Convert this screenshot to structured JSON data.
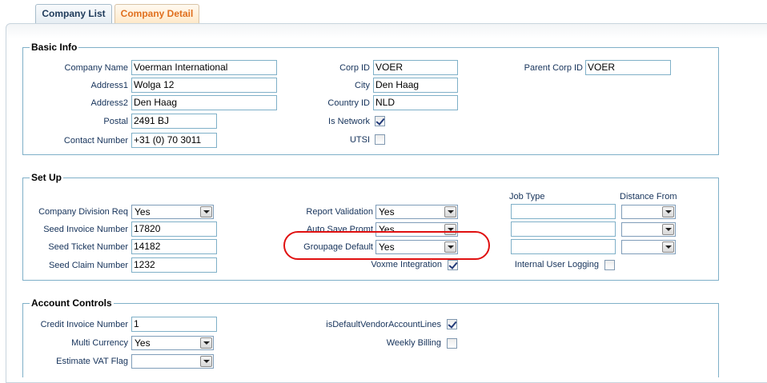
{
  "tabs": {
    "company_list": "Company List",
    "company_detail": "Company Detail"
  },
  "basic_info": {
    "legend": "Basic Info",
    "company_name": {
      "label": "Company Name",
      "value": "Voerman International"
    },
    "address1": {
      "label": "Address1",
      "value": "Wolga 12"
    },
    "address2": {
      "label": "Address2",
      "value": "Den Haag"
    },
    "postal": {
      "label": "Postal",
      "value": "2491 BJ"
    },
    "contact_number": {
      "label": "Contact Number",
      "value": "+31 (0) 70 3011"
    },
    "corp_id": {
      "label": "Corp ID",
      "value": "VOER"
    },
    "city": {
      "label": "City",
      "value": "Den Haag"
    },
    "country_id": {
      "label": "Country ID",
      "value": "NLD"
    },
    "is_network": {
      "label": "Is Network",
      "checked": true
    },
    "utsi": {
      "label": "UTSI",
      "checked": false
    },
    "parent_corp_id": {
      "label": "Parent Corp ID",
      "value": "VOER"
    }
  },
  "set_up": {
    "legend": "Set Up",
    "company_division_req": {
      "label": "Company Division Req",
      "value": "Yes"
    },
    "seed_invoice_number": {
      "label": "Seed Invoice Number",
      "value": "17820"
    },
    "seed_ticket_number": {
      "label": "Seed Ticket Number",
      "value": "14182"
    },
    "seed_claim_number": {
      "label": "Seed Claim Number",
      "value": "1232"
    },
    "report_validation": {
      "label": "Report Validation",
      "value": "Yes"
    },
    "auto_save_promt": {
      "label": "Auto Save Promt",
      "value": "Yes"
    },
    "groupage_default": {
      "label": "Groupage Default",
      "value": "Yes"
    },
    "voxme_integration": {
      "label": "Voxme Integration",
      "checked": true
    },
    "job_type_header": "Job Type",
    "distance_from_header": "Distance From",
    "internal_user_logging": {
      "label": "Internal User Logging",
      "checked": false
    }
  },
  "account_controls": {
    "legend": "Account Controls",
    "credit_invoice_number": {
      "label": "Credit Invoice Number",
      "value": "1"
    },
    "multi_currency": {
      "label": "Multi Currency",
      "value": "Yes"
    },
    "estimate_vat_flag": {
      "label": "Estimate VAT Flag",
      "value": ""
    },
    "is_default_vendor_account_lines": {
      "label": "isDefaultVendorAccountLines",
      "checked": true
    },
    "weekly_billing": {
      "label": "Weekly Billing",
      "checked": false
    }
  },
  "colors": {
    "active_tab_text": "#e0701e",
    "highlight": "#e01010",
    "field_border": "#7fb0c8"
  }
}
